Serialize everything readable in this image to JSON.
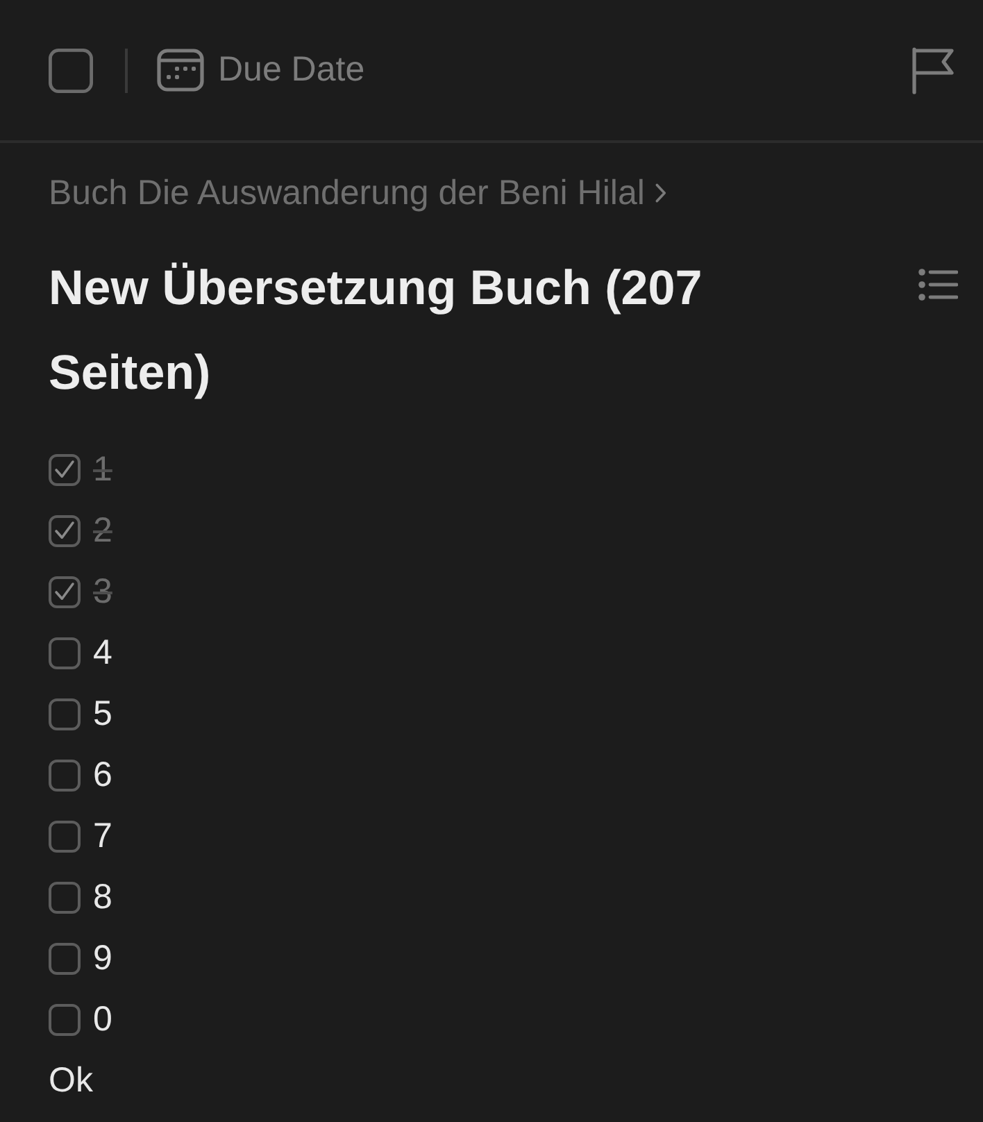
{
  "toolbar": {
    "task_checked": false,
    "due_date": {
      "label": "Due Date"
    }
  },
  "breadcrumb": {
    "text": "Buch Die Auswanderung der Beni Hilal"
  },
  "title": "New Übersetzung Buch (207 Seiten)",
  "content": [
    {
      "kind": "checkbox",
      "text": "1",
      "checked": true
    },
    {
      "kind": "checkbox",
      "text": "2",
      "checked": true
    },
    {
      "kind": "checkbox",
      "text": "3",
      "checked": true
    },
    {
      "kind": "checkbox",
      "text": "4",
      "checked": false
    },
    {
      "kind": "checkbox",
      "text": "5",
      "checked": false
    },
    {
      "kind": "checkbox",
      "text": "6",
      "checked": false
    },
    {
      "kind": "checkbox",
      "text": "7",
      "checked": false
    },
    {
      "kind": "checkbox",
      "text": "8",
      "checked": false
    },
    {
      "kind": "checkbox",
      "text": "9",
      "checked": false
    },
    {
      "kind": "checkbox",
      "text": "0",
      "checked": false
    },
    {
      "kind": "text",
      "text": "Ok"
    }
  ]
}
